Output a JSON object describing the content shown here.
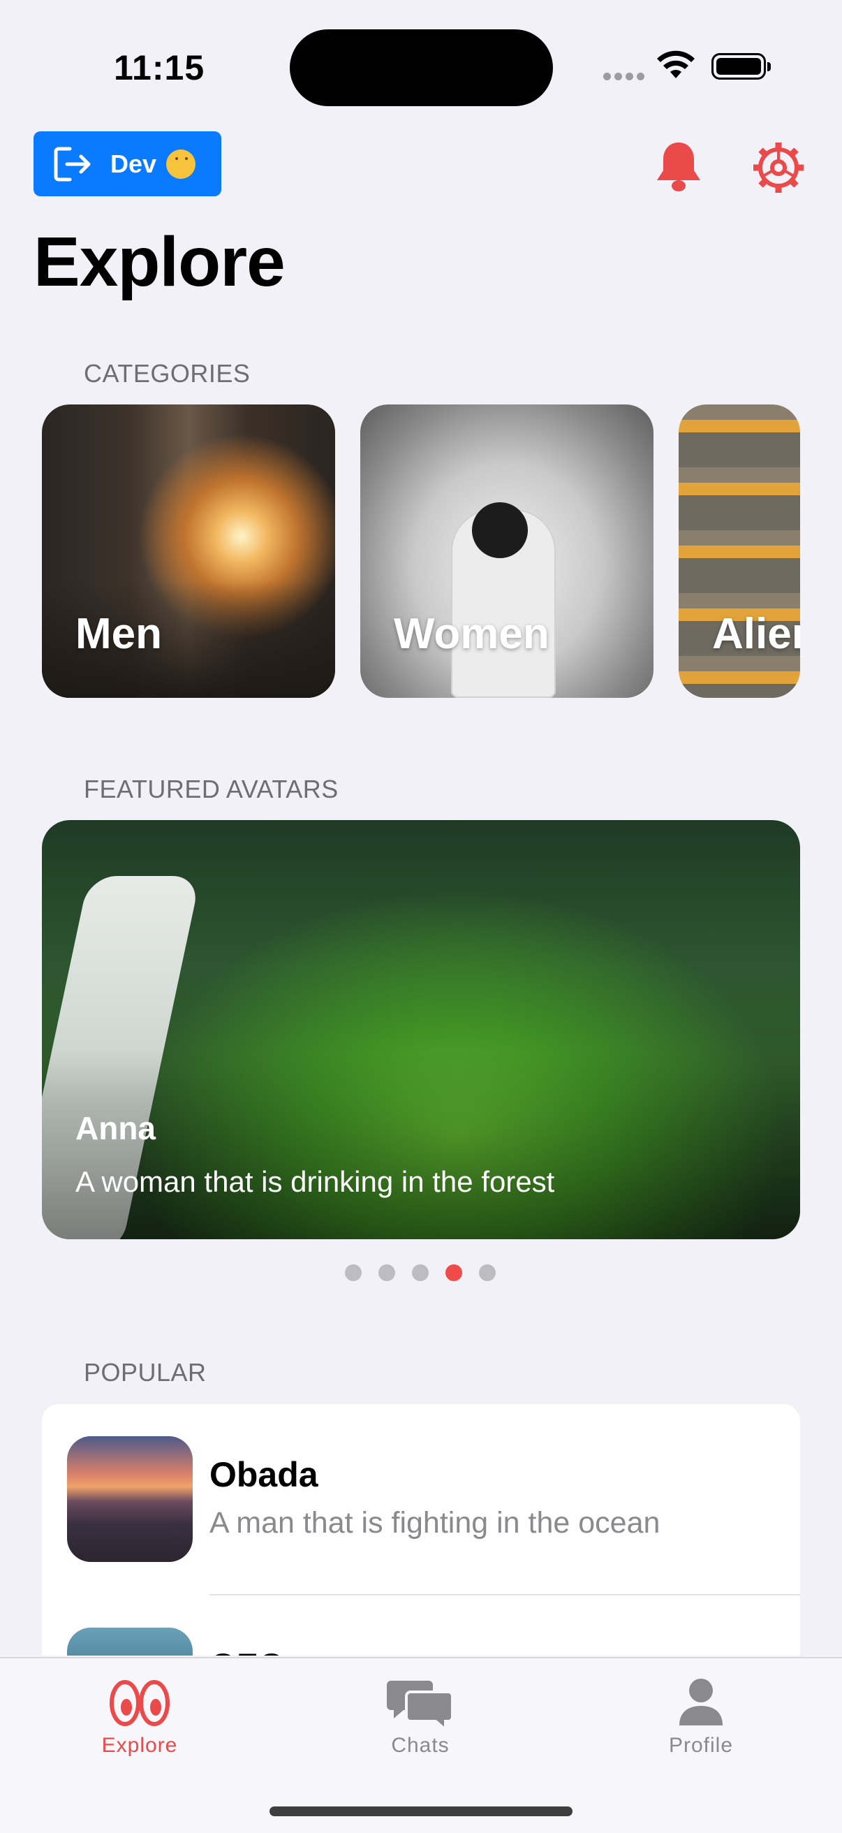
{
  "status_bar": {
    "time": "11:15"
  },
  "header": {
    "dev_button_label": "Dev",
    "title": "Explore"
  },
  "sections": {
    "categories": "CATEGORIES",
    "featured": "FEATURED AVATARS",
    "popular": "POPULAR"
  },
  "categories": [
    {
      "label": "Men"
    },
    {
      "label": "Women"
    },
    {
      "label": "Alien"
    }
  ],
  "featured": {
    "name": "Anna",
    "description": "A woman that is drinking in the forest",
    "pages": 5,
    "active_page": 4
  },
  "popular": [
    {
      "name": "Obada",
      "description": "A man that is fighting in the ocean"
    },
    {
      "name": "OZO",
      "description": ""
    }
  ],
  "tabs": [
    {
      "label": "Explore",
      "icon": "eyes-icon",
      "active": true
    },
    {
      "label": "Chats",
      "icon": "chat-bubbles-icon",
      "active": false
    },
    {
      "label": "Profile",
      "icon": "person-icon",
      "active": false
    }
  ],
  "colors": {
    "accent": "#EA4A4A",
    "dev_button": "#0A7AFF",
    "background": "#F2F1F7"
  }
}
